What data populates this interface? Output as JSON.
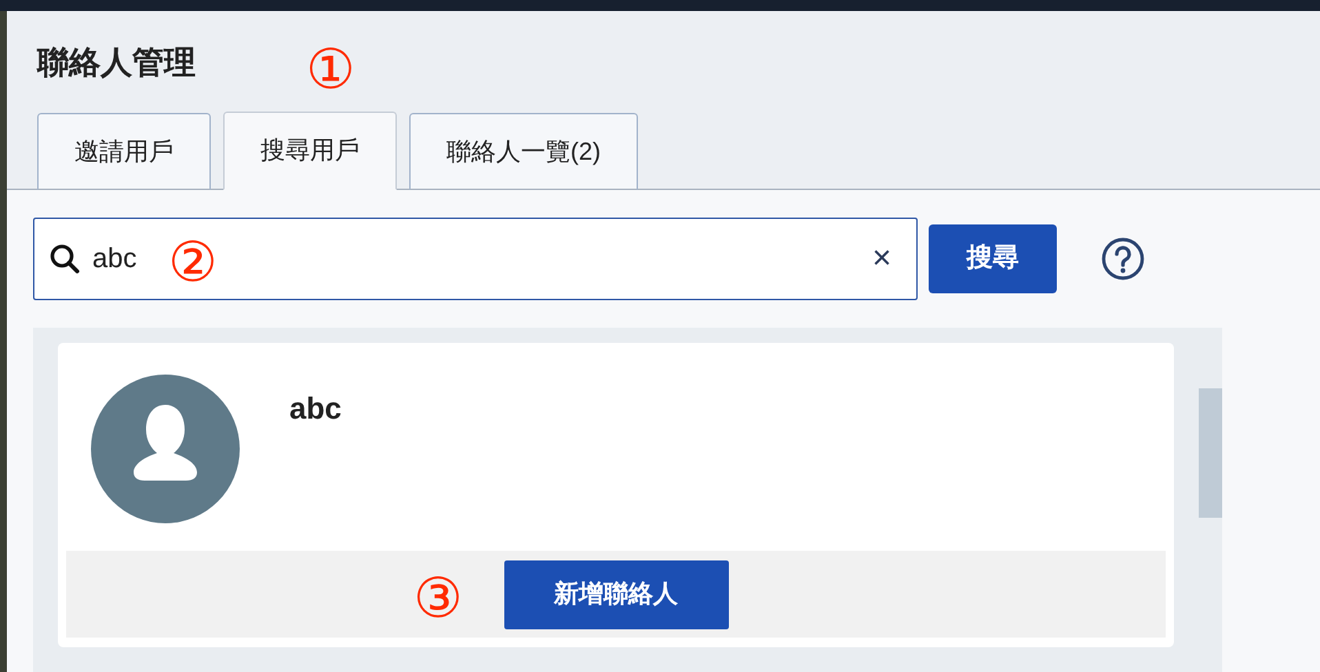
{
  "panel": {
    "title": "聯絡人管理"
  },
  "tabs": [
    {
      "label": "邀請用戶",
      "selected": false
    },
    {
      "label": "搜尋用戶",
      "selected": true
    },
    {
      "label": "聯絡人一覽(2)",
      "selected": false
    }
  ],
  "search": {
    "value": "abc",
    "clear": "×",
    "button": "搜尋"
  },
  "results": [
    {
      "name": "abc",
      "action": "新增聯絡人"
    }
  ],
  "callouts": [
    {
      "label": "①"
    },
    {
      "label": "②"
    },
    {
      "label": "③"
    }
  ]
}
